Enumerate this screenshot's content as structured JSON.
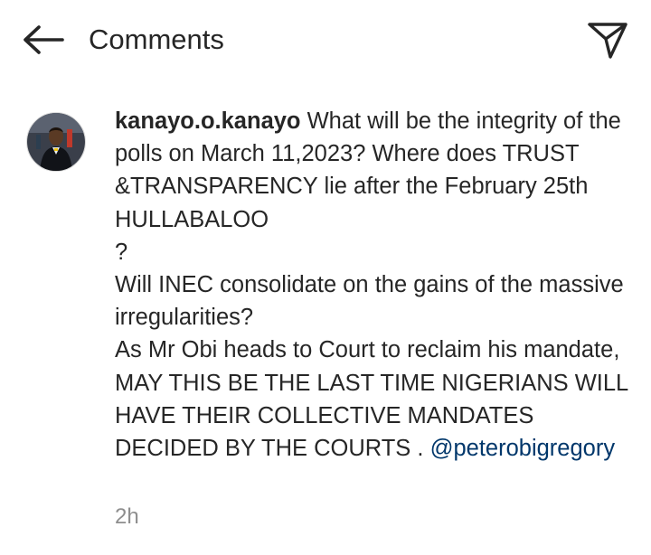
{
  "header": {
    "title": "Comments",
    "back_icon": "arrow-left-icon",
    "send_icon": "paper-plane-icon"
  },
  "comment": {
    "avatar_icon": "user-avatar",
    "username": "kanayo.o.kanayo",
    "text": " What will be the integrity of the polls on March 11,2023? Where does TRUST &TRANSPARENCY lie after the February 25th HULLABALOO\n?\nWill INEC consolidate on the gains of the massive irregularities?\nAs Mr Obi heads to Court to reclaim his mandate,  MAY THIS BE THE LAST TIME NIGERIANS WILL HAVE THEIR COLLECTIVE MANDATES DECIDED BY THE COURTS . ",
    "mention": "@peterobigregory",
    "time": "2h"
  },
  "colors": {
    "text": "#262626",
    "mention": "#00376b",
    "muted": "#8e8e8e",
    "background": "#ffffff"
  }
}
